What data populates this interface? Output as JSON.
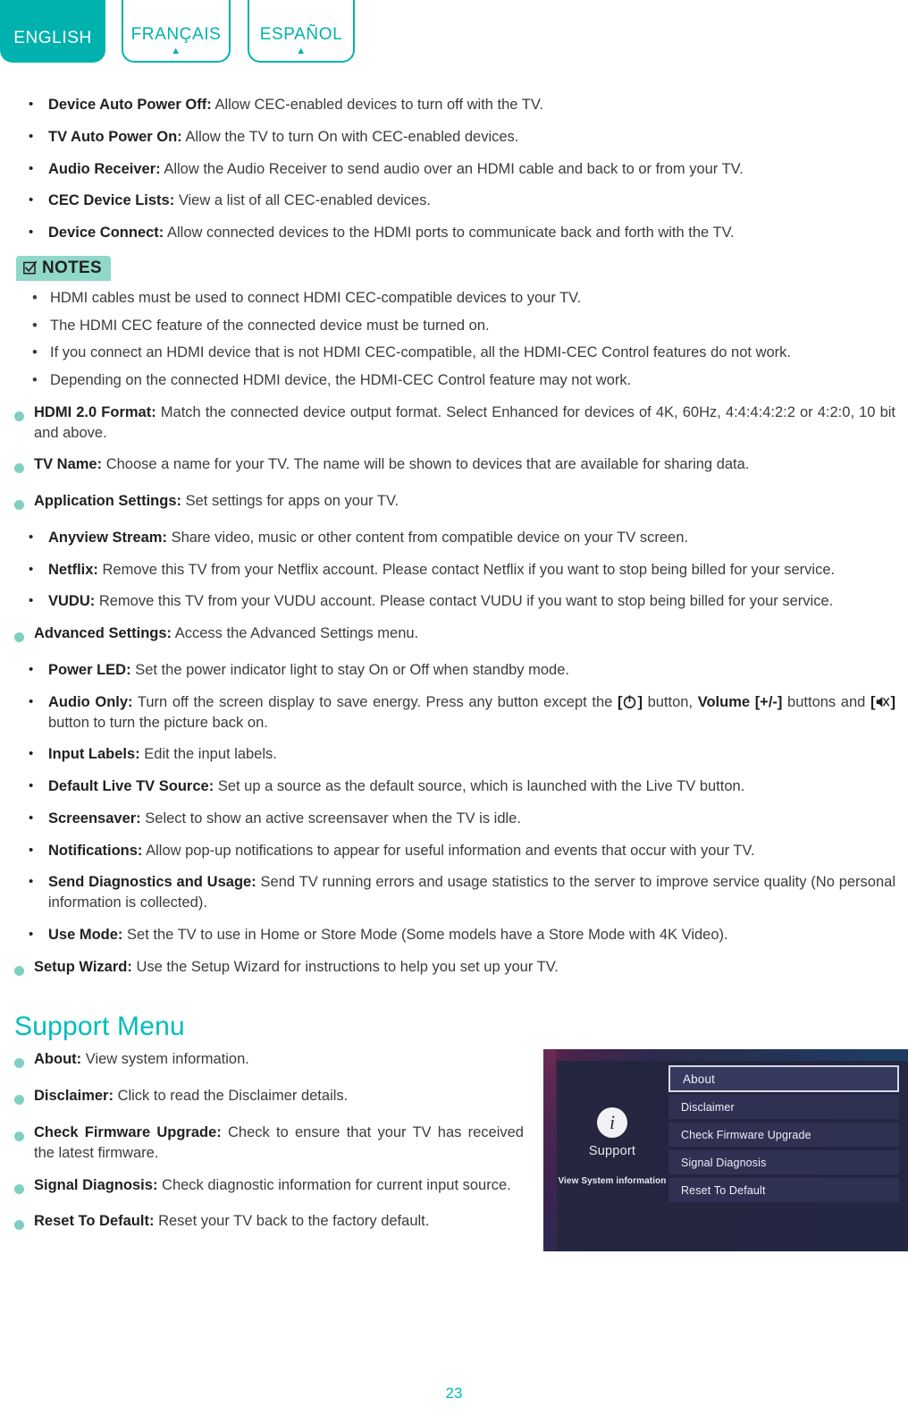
{
  "languages": [
    {
      "label": "ENGLISH",
      "active": true,
      "caret": ""
    },
    {
      "label": "FRANÇAIS",
      "active": false,
      "caret": "▲"
    },
    {
      "label": "ESPAÑOL",
      "active": false,
      "caret": "▲"
    }
  ],
  "cec_items": [
    {
      "term": "Device Auto Power Off:",
      "desc": "Allow CEC-enabled devices to turn off with the TV."
    },
    {
      "term": "TV Auto Power On:",
      "desc": "Allow the TV to turn On with CEC-enabled devices."
    },
    {
      "term": "Audio Receiver:",
      "desc": "Allow the Audio Receiver to send audio over an HDMI cable and back to or from your TV."
    },
    {
      "term": "CEC Device Lists:",
      "desc": "View a list of all CEC-enabled devices."
    },
    {
      "term": "Device Connect:",
      "desc": "Allow connected devices to the HDMI ports to communicate back and forth with the TV."
    }
  ],
  "notes": {
    "badge_label": "NOTES",
    "badge_icon": "checkbox-checked-icon",
    "items": [
      "HDMI cables must be used to connect HDMI CEC-compatible devices to your TV.",
      "The HDMI CEC feature of the connected device must be turned on.",
      "If you connect an HDMI device that is not HDMI CEC-compatible, all the HDMI-CEC Control features do not work.",
      "Depending on the connected HDMI device, the HDMI-CEC Control feature may not work."
    ]
  },
  "hdmi_format": {
    "term": "HDMI 2.0 Format:",
    "desc": "Match the connected device output format. Select Enhanced for devices of 4K, 60Hz, 4:4:4:4:2:2 or 4:2:0, 10 bit and above."
  },
  "tv_name": {
    "term": "TV Name:",
    "desc": "Choose a name for your TV. The name will be shown to devices that are available for sharing data."
  },
  "application_settings": {
    "term": "Application Settings:",
    "desc": "Set settings for apps on your TV.",
    "children": [
      {
        "term": "Anyview Stream:",
        "desc": "Share video, music or other content from compatible device on your TV screen."
      },
      {
        "term": "Netflix:",
        "desc": "Remove this TV from your Netflix account. Please contact Netflix if you want to stop being billed for your service."
      },
      {
        "term": "VUDU:",
        "desc": "Remove this TV from your VUDU account. Please contact VUDU if you want to stop being billed for your service."
      }
    ]
  },
  "advanced_settings": {
    "term": "Advanced Settings:",
    "desc": "Access the Advanced Settings menu.",
    "children": [
      {
        "term": "Power LED:",
        "desc": "Set the power indicator light to stay On or Off when standby mode."
      },
      {
        "term": "Audio Only:",
        "desc_part1": "Turn off the screen display to save energy. Press any button except the",
        "bracket1_open": "[",
        "icon1": "power-icon",
        "bracket1_close": "]",
        "desc_part2": "button,",
        "volume_label": "Volume [+/-]",
        "desc_part3": "buttons and",
        "bracket2_open": "[",
        "icon2": "mute-icon",
        "bracket2_close": "]",
        "desc_part4": "button to turn the picture back on."
      },
      {
        "term": "Input Labels:",
        "desc": "Edit the input labels."
      },
      {
        "term": "Default Live TV Source:",
        "desc": "Set up a source as the default source, which is launched with the Live TV button."
      },
      {
        "term": "Screensaver:",
        "desc": "Select to show an active screensaver when the TV is idle."
      },
      {
        "term": "Notifications:",
        "desc": "Allow pop-up notifications to appear for useful information and events that occur with your TV."
      },
      {
        "term": "Send Diagnostics and Usage:",
        "desc": "Send TV running errors and usage statistics to the server to improve service quality (No personal information is collected)."
      },
      {
        "term": "Use Mode:",
        "desc": "Set the TV to use in Home or Store Mode (Some models have a Store Mode with 4K Video)."
      }
    ]
  },
  "setup_wizard": {
    "term": "Setup Wizard:",
    "desc": "Use the Setup Wizard for instructions to help you set up your TV."
  },
  "support_menu": {
    "title": "Support Menu",
    "items": [
      {
        "term": "About:",
        "desc": "View system information."
      },
      {
        "term": "Disclaimer:",
        "desc": "Click to read the Disclaimer details."
      },
      {
        "term": "Check Firmware Upgrade:",
        "desc": "Check to ensure that your TV has received the latest firmware."
      },
      {
        "term": "Signal Diagnosis:",
        "desc": "Check diagnostic information for current input source."
      },
      {
        "term": "Reset To Default:",
        "desc": "Reset your TV back to the factory default."
      }
    ]
  },
  "tv_screenshot": {
    "left_icon": "info-icon",
    "left_title": "Support",
    "left_subtitle": "View System information",
    "menu": [
      {
        "label": "About",
        "selected": true
      },
      {
        "label": "Disclaimer",
        "selected": false
      },
      {
        "label": "Check Firmware Upgrade",
        "selected": false
      },
      {
        "label": "Signal Diagnosis",
        "selected": false
      },
      {
        "label": "Reset To Default",
        "selected": false
      }
    ]
  },
  "page_number": "23",
  "colors": {
    "brand_teal": "#00b2ae",
    "heading_teal": "#00bcbc",
    "bullet_mint": "#7fd0c1",
    "notes_badge_bg": "#8fd8ca"
  }
}
